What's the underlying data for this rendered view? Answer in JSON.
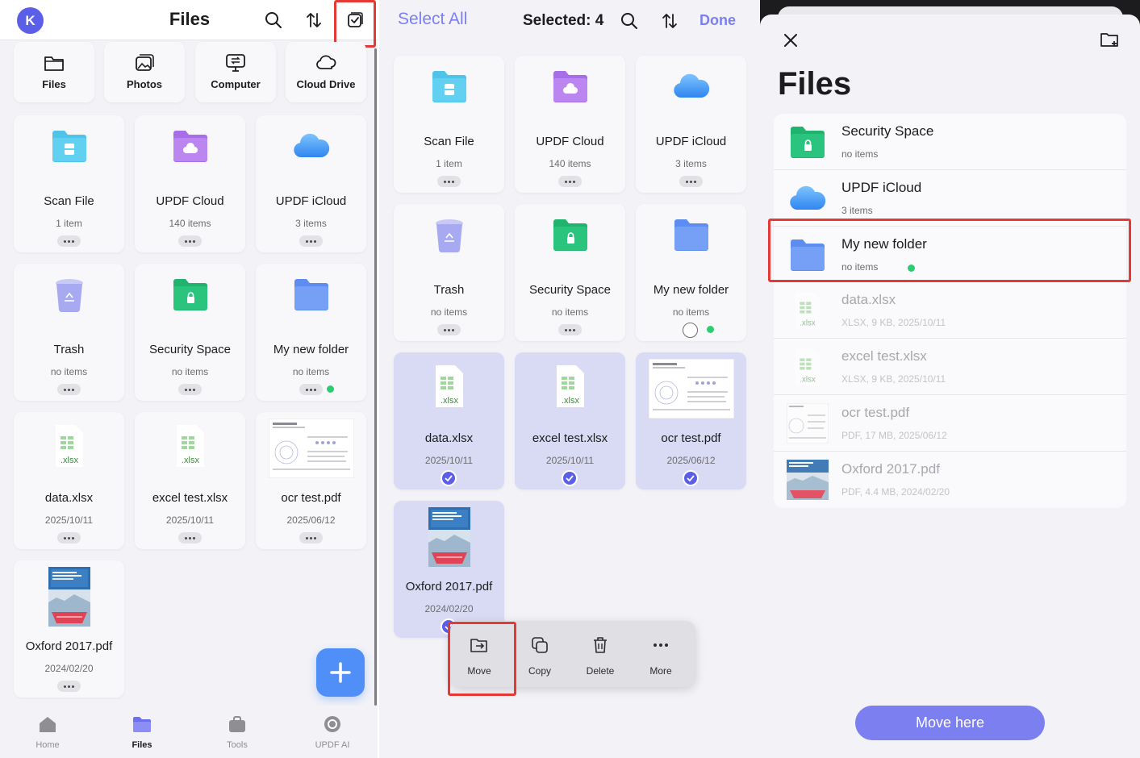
{
  "panel_left": {
    "avatar_letter": "K",
    "title": "Files",
    "categories": [
      {
        "label": "Files",
        "icon": "folder-outline-icon"
      },
      {
        "label": "Photos",
        "icon": "photos-icon"
      },
      {
        "label": "Computer",
        "icon": "computer-icon"
      },
      {
        "label": "Cloud Drive",
        "icon": "cloud-outline-icon"
      }
    ],
    "items": [
      {
        "name": "Scan File",
        "sub": "1 item",
        "icon": "scan-folder-icon"
      },
      {
        "name": "UPDF Cloud",
        "sub": "140 items",
        "icon": "updf-cloud-folder-icon"
      },
      {
        "name": "UPDF iCloud",
        "sub": "3 items",
        "icon": "icloud-icon"
      },
      {
        "name": "Trash",
        "sub": "no items",
        "icon": "trash-icon"
      },
      {
        "name": "Security Space",
        "sub": "no items",
        "icon": "security-folder-icon"
      },
      {
        "name": "My new folder",
        "sub": "no items",
        "icon": "folder-icon"
      },
      {
        "name": "data.xlsx",
        "sub": "2025/10/11",
        "icon": "xlsx-file-icon",
        "ext": ".xlsx"
      },
      {
        "name": "excel test.xlsx",
        "sub": "2025/10/11",
        "icon": "xlsx-file-icon",
        "ext": ".xlsx"
      },
      {
        "name": "ocr test.pdf",
        "sub": "2025/06/12",
        "icon": "pdf-thumbnail-icon"
      },
      {
        "name": "Oxford 2017.pdf",
        "sub": "2024/02/20",
        "icon": "pdf-thumbnail-icon"
      }
    ],
    "tabs": [
      {
        "label": "Home",
        "icon": "home-icon"
      },
      {
        "label": "Files",
        "icon": "files-tab-icon"
      },
      {
        "label": "Tools",
        "icon": "tools-icon"
      },
      {
        "label": "UPDF AI",
        "icon": "ai-icon"
      }
    ]
  },
  "panel_middle": {
    "select_all": "Select All",
    "selected": "Selected: 4",
    "done": "Done",
    "items": [
      {
        "name": "Scan File",
        "sub": "1 item"
      },
      {
        "name": "UPDF Cloud",
        "sub": "140 items"
      },
      {
        "name": "UPDF iCloud",
        "sub": "3 items"
      },
      {
        "name": "Trash",
        "sub": "no items"
      },
      {
        "name": "Security Space",
        "sub": "no items"
      },
      {
        "name": "My new folder",
        "sub": "no items"
      },
      {
        "name": "data.xlsx",
        "sub": "2025/10/11",
        "ext": ".xlsx"
      },
      {
        "name": "excel test.xlsx",
        "sub": "2025/10/11",
        "ext": ".xlsx"
      },
      {
        "name": "ocr test.pdf",
        "sub": "2025/06/12"
      },
      {
        "name": "Oxford 2017.pdf",
        "sub": "2024/02/20"
      }
    ],
    "actions": [
      {
        "label": "Move",
        "icon": "move-icon"
      },
      {
        "label": "Copy",
        "icon": "copy-icon"
      },
      {
        "label": "Delete",
        "icon": "trash-icon"
      },
      {
        "label": "More",
        "icon": "more-icon"
      }
    ]
  },
  "panel_right": {
    "title": "Files",
    "rows": [
      {
        "name": "Security Space",
        "sub": "no items"
      },
      {
        "name": "UPDF iCloud",
        "sub": "3 items"
      },
      {
        "name": "My new folder",
        "sub": "no items"
      },
      {
        "name": "data.xlsx",
        "sub": "XLSX, 9 KB, 2025/10/11",
        "ext": ".xlsx"
      },
      {
        "name": "excel test.xlsx",
        "sub": "XLSX, 9 KB, 2025/10/11",
        "ext": ".xlsx"
      },
      {
        "name": "ocr test.pdf",
        "sub": "PDF, 17 MB, 2025/06/12"
      },
      {
        "name": "Oxford 2017.pdf",
        "sub": "PDF, 4.4 MB, 2024/02/20"
      }
    ],
    "move_here": "Move here"
  },
  "colors": {
    "accent": "#7b7ff0",
    "highlight": "#e53935",
    "online_dot": "#2ecc71"
  }
}
